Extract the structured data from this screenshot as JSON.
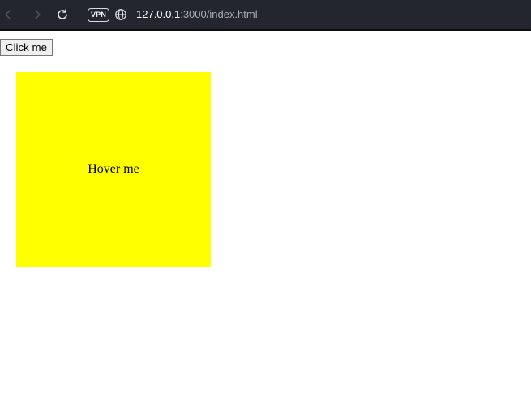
{
  "browser": {
    "url_host": "127.0.0.1",
    "url_path": ":3000/index.html",
    "vpn_label": "VPN",
    "bar_color": "#23252f"
  },
  "page": {
    "button_label": "Click me",
    "hover_box_text": "Hover me",
    "hover_box_color": "#ffff00"
  }
}
